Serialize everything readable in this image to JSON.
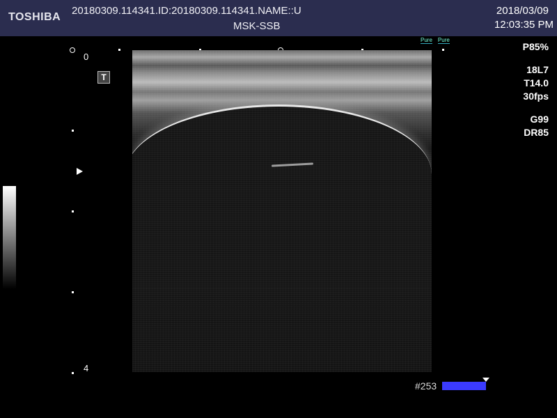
{
  "header": {
    "brand": "TOSHIBA",
    "patient_line": "20180309.114341.ID:20180309.114341.NAME::U",
    "preset": "MSK-SSB",
    "date": "2018/03/09",
    "time": "12:03:35 PM"
  },
  "depth_scale": {
    "top": "0",
    "bottom": "4"
  },
  "icons": {
    "mode_icon": "T",
    "pure_left": "Pure",
    "pure_right": "Pure"
  },
  "params": {
    "power": "P85%",
    "probe": "18L7",
    "freq": "T14.0",
    "fps": "30fps",
    "gain": "G99",
    "dr": "DR85"
  },
  "cine": {
    "frame": "#253"
  },
  "colors": {
    "header_bg": "#2b2d4f",
    "cine_bar": "#3b3bff"
  }
}
